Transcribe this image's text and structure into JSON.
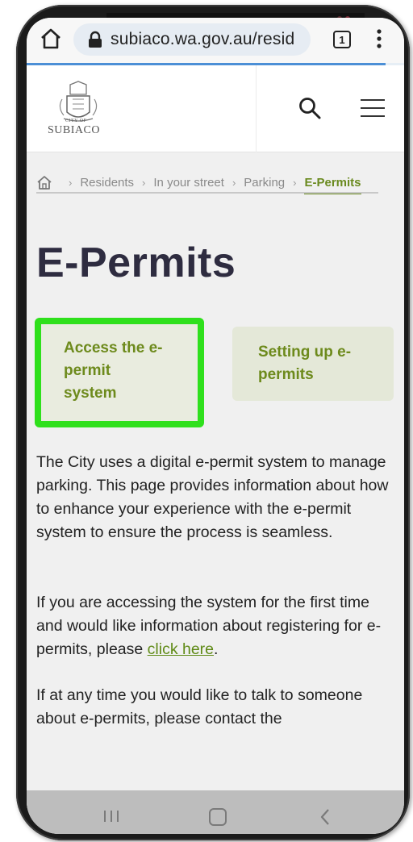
{
  "browser": {
    "url": "subiaco.wa.gov.au/resid",
    "tab_count": "1",
    "load_progress_percent": 95
  },
  "site": {
    "logo_text": "SUBIACO",
    "logo_subtext": "CITY OF"
  },
  "breadcrumb": {
    "items": [
      "Residents",
      "In your street",
      "Parking"
    ],
    "current": "E-Permits"
  },
  "page": {
    "title": "E-Permits",
    "cards": [
      {
        "label_line1": "Access the e-",
        "label_line2": "permit",
        "label_line3": "system"
      },
      {
        "label_line1": "Setting up e-",
        "label_line2": "permits"
      }
    ],
    "para1": "The City uses a digital e-permit system to manage parking. This page provides information about how to enhance your experience with the e-permit system to ensure the process is seamless.",
    "para2_before": "If you are accessing the system for the first time and would like information about registering for e-permits, please ",
    "para2_link": "click here",
    "para2_after": ".",
    "para3": "If at any time you would like to talk to someone about e-permits, please contact the"
  },
  "colors": {
    "accent_green": "#6d8a1c",
    "highlight_box": "#2fe01c",
    "title_color": "#2e2c40"
  },
  "icons": {
    "home": "home-icon",
    "lock": "lock-icon",
    "search": "search-icon",
    "menu": "hamburger-icon",
    "more": "kebab-menu-icon"
  }
}
